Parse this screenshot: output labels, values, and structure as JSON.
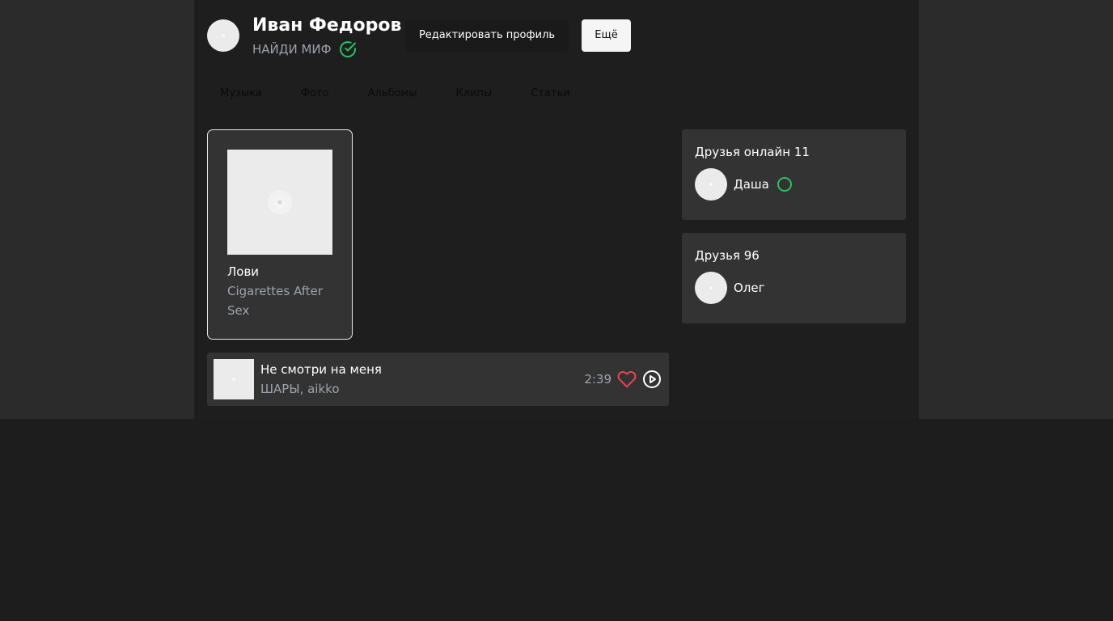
{
  "profile": {
    "name": "Иван Федоров",
    "status": "НАЙДИ МИФ",
    "verified_icon": "check-circle-icon",
    "accent_color": "#22c55e"
  },
  "header_buttons": {
    "edit_label": "Редактировать профиль",
    "more_label": "Ещё"
  },
  "tabs": [
    {
      "label": "Музыка"
    },
    {
      "label": "Фото"
    },
    {
      "label": "Альбомы"
    },
    {
      "label": "Клипы"
    },
    {
      "label": "Статьи"
    }
  ],
  "album_card": {
    "title": "Лови",
    "artist": "Cigarettes After Sex"
  },
  "track": {
    "title": "Не смотри на меня",
    "artist": "ШАРЫ, aikko",
    "duration": "2:39",
    "like_icon": "heart-icon",
    "play_icon": "play-circle-icon",
    "like_color": "#e5484d"
  },
  "friends_online": {
    "title": "Друзья онлайн 11",
    "items": [
      {
        "name": "Даша"
      }
    ]
  },
  "friends": {
    "title": "Друзья 96",
    "items": [
      {
        "name": "Олег"
      }
    ]
  }
}
